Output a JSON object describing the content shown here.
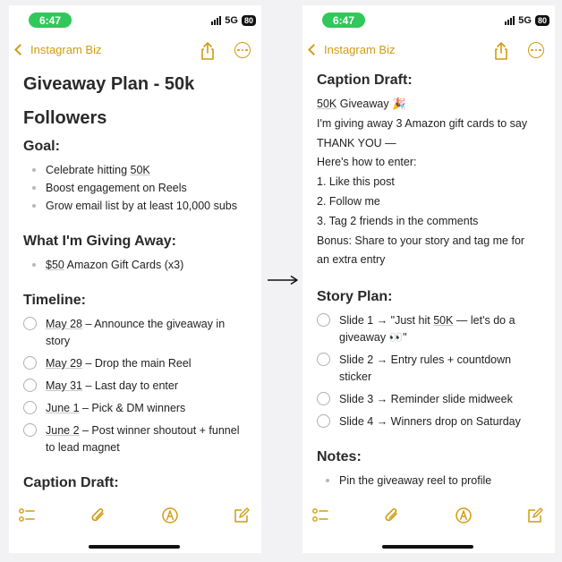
{
  "status": {
    "time": "6:47",
    "network": "5G",
    "battery": "80"
  },
  "nav": {
    "back_label": "Instagram Biz"
  },
  "left": {
    "title_line1": "Giveaway Plan - 50k",
    "title_line2": "Followers",
    "goal": {
      "heading": "Goal:",
      "items": [
        {
          "pre": "Celebrate hitting ",
          "link": "50K",
          "post": ""
        },
        {
          "pre": "Boost engagement on Reels",
          "link": "",
          "post": ""
        },
        {
          "pre": "Grow email list by at least 10,000 subs",
          "link": "",
          "post": ""
        }
      ]
    },
    "giving": {
      "heading": "What I'm Giving Away:",
      "items": [
        {
          "pre": "",
          "link": "$50",
          "post": " Amazon Gift Cards (x3)"
        }
      ]
    },
    "timeline": {
      "heading": "Timeline:",
      "items": [
        {
          "date": "May 28",
          "l1": " – Announce the giveaway in",
          "l2": "story"
        },
        {
          "date": "May 29",
          "l1": " – Drop the main Reel",
          "l2": ""
        },
        {
          "date": "May 31",
          "l1": " – Last day to enter",
          "l2": ""
        },
        {
          "date": "June 1",
          "l1": " – Pick & DM winners",
          "l2": ""
        },
        {
          "date": "June 2",
          "l1": " – Post winner shoutout + funnel",
          "l2": "to lead magnet"
        }
      ]
    },
    "caption_heading": "Caption Draft:"
  },
  "right": {
    "caption": {
      "heading": "Caption Draft:",
      "first_link": "50K",
      "first_rest": " Giveaway 🎉",
      "lines": [
        "I'm giving away 3 Amazon gift cards to say",
        "THANK YOU —",
        "Here's how to enter:",
        "1. Like this post",
        "2. Follow me",
        "3. Tag 2 friends in the comments",
        "Bonus: Share to your story and tag me for",
        "an extra entry"
      ]
    },
    "story": {
      "heading": "Story Plan:",
      "items": [
        {
          "pre": "Slide 1 → \"Just hit ",
          "link": "50K",
          "post": " — let's do a",
          "l2": "giveaway 👀\""
        },
        {
          "pre": "Slide 2 → Entry rules + countdown",
          "link": "",
          "post": "",
          "l2": "sticker"
        },
        {
          "pre": "Slide 3 → Reminder slide midweek",
          "link": "",
          "post": "",
          "l2": ""
        },
        {
          "pre": "Slide 4 → Winners drop on Saturday",
          "link": "",
          "post": "",
          "l2": ""
        }
      ]
    },
    "notes": {
      "heading": "Notes:",
      "items": [
        "Pin the giveaway reel to profile"
      ]
    }
  },
  "colors": {
    "accent": "#cf9c12",
    "status_pill": "#30c85a"
  },
  "icons": {
    "toolbar": [
      "checklist-icon",
      "paperclip-icon",
      "markup-pen-icon",
      "compose-icon"
    ],
    "nav": [
      "chevron-left-icon",
      "share-icon",
      "more-icon"
    ]
  }
}
